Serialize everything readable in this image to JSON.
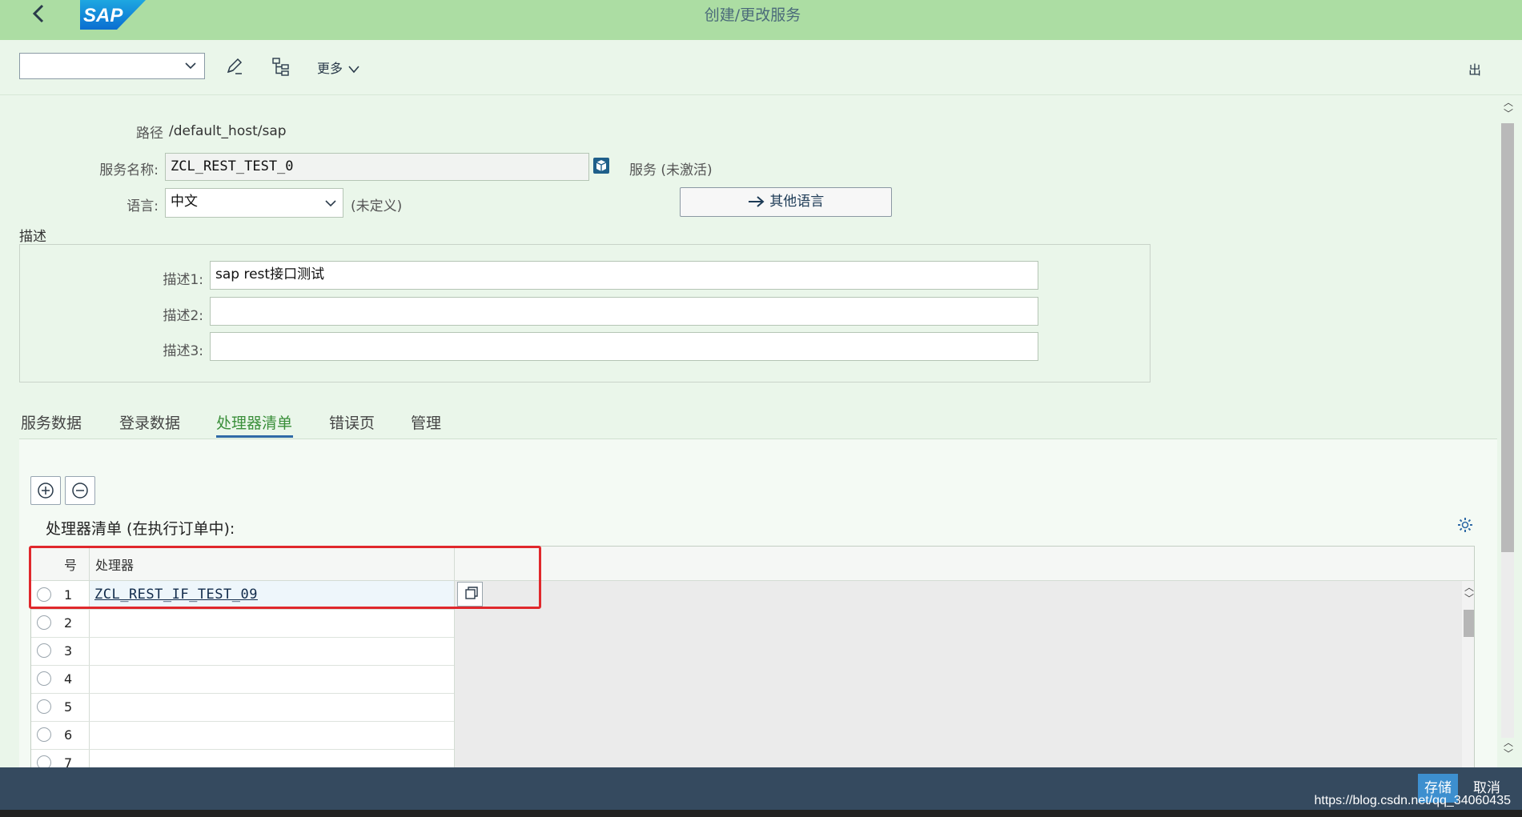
{
  "header": {
    "title": "创建/更改服务",
    "logo_text": "SAP"
  },
  "toolbar": {
    "select_value": "",
    "more_label": "更多",
    "exit_label": "出"
  },
  "form": {
    "path_label": "路径",
    "path_value": "/default_host/sap",
    "service_name_label": "服务名称:",
    "service_name_value": "ZCL_REST_TEST_0",
    "service_status": "服务 (未激活)",
    "language_label": "语言:",
    "language_value": "中文",
    "language_status": "(未定义)",
    "other_language_button": "其他语言",
    "description_section": "描述",
    "desc1_label": "描述1:",
    "desc1_value": "sap rest接口测试",
    "desc2_label": "描述2:",
    "desc2_value": "",
    "desc3_label": "描述3:",
    "desc3_value": ""
  },
  "tabs": [
    {
      "label": "服务数据",
      "active": false
    },
    {
      "label": "登录数据",
      "active": false
    },
    {
      "label": "处理器清单",
      "active": true
    },
    {
      "label": "错误页",
      "active": false
    },
    {
      "label": "管理",
      "active": false
    }
  ],
  "handler_table": {
    "title": "处理器清单 (在执行订单中):",
    "columns": [
      "号",
      "处理器"
    ],
    "rows": [
      {
        "no": "1",
        "handler": "ZCL_REST_IF_TEST_09"
      },
      {
        "no": "2",
        "handler": ""
      },
      {
        "no": "3",
        "handler": ""
      },
      {
        "no": "4",
        "handler": ""
      },
      {
        "no": "5",
        "handler": ""
      },
      {
        "no": "6",
        "handler": ""
      },
      {
        "no": "7",
        "handler": ""
      }
    ]
  },
  "footer": {
    "save_label": "存储",
    "cancel_label": "取消",
    "watermark": "https://blog.csdn.net/qq_34060435"
  },
  "colors": {
    "header_bg": "#acdda3",
    "page_bg": "#eaf6ea",
    "footer_bg": "#354a5f",
    "active_tab": "#3a8f3a",
    "highlight_box": "#e0282c",
    "save_button": "#3d8fcf"
  }
}
